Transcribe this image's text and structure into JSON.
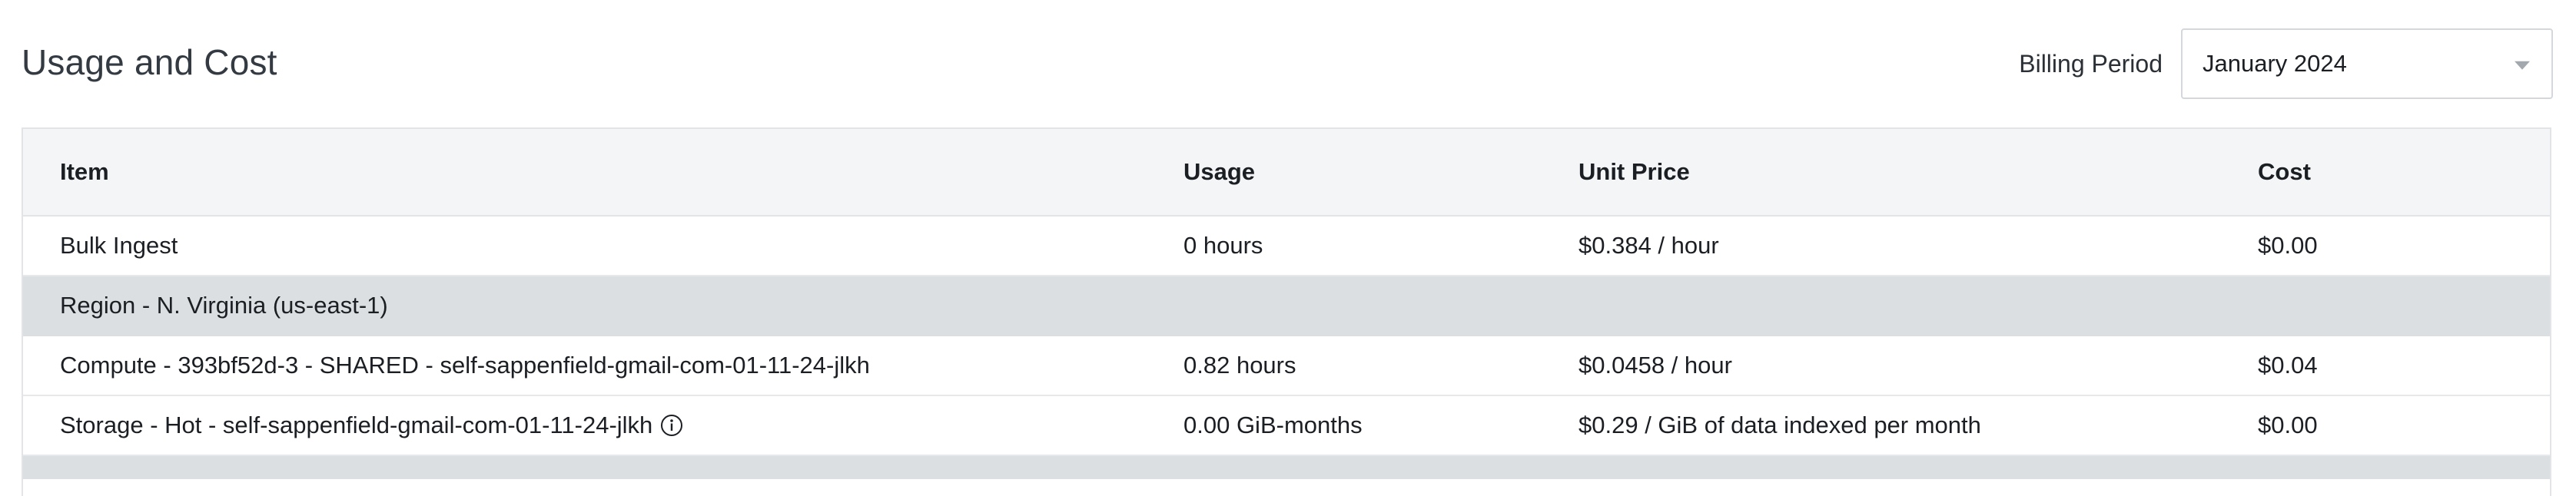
{
  "header": {
    "title": "Usage and Cost",
    "billing_label": "Billing Period",
    "billing_value": "January 2024"
  },
  "table": {
    "columns": [
      "Item",
      "Usage",
      "Unit Price",
      "Cost"
    ],
    "rows": [
      {
        "item": "Bulk Ingest",
        "usage": "0 hours",
        "unit_price": "$0.384 / hour",
        "cost": "$0.00"
      },
      {
        "region": "Region - N. Virginia (us-east-1)"
      },
      {
        "item": "Compute - 393bf52d-3 - SHARED - self-sappenfield-gmail-com-01-11-24-jlkh",
        "usage": "0.82 hours",
        "unit_price": "$0.0458 / hour",
        "cost": "$0.04"
      },
      {
        "item": "Storage - Hot - self-sappenfield-gmail-com-01-11-24-jlkh",
        "usage": "0.00 GiB-months",
        "unit_price": "$0.29 / GiB of data indexed per month",
        "cost": "$0.00",
        "icon": "info-icon"
      }
    ]
  }
}
